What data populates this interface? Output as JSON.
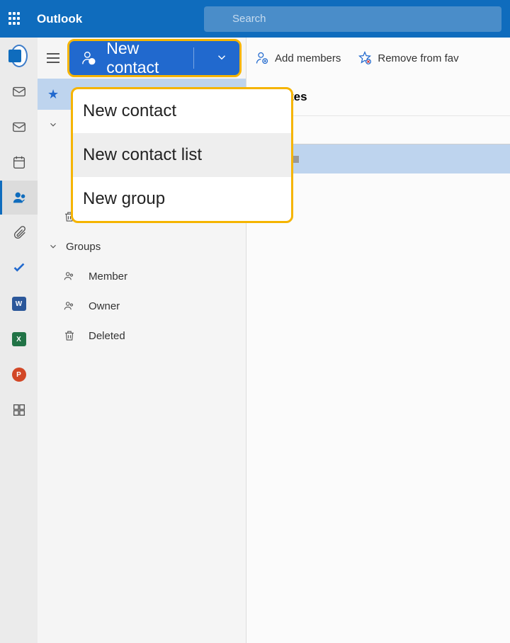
{
  "header": {
    "title": "Outlook",
    "search_placeholder": "Search"
  },
  "toolbar": {
    "new_contact": "New contact",
    "add_members": "Add members",
    "remove_favorites": "Remove from fav"
  },
  "dropdown": {
    "items": [
      "New contact",
      "New contact list",
      "New group"
    ]
  },
  "sidebar": {
    "deleted": "Deleted",
    "groups_header": "Groups",
    "groups": {
      "member": "Member",
      "owner": "Owner",
      "deleted": "Deleted"
    }
  },
  "content": {
    "favorites_header": "Favorites"
  }
}
